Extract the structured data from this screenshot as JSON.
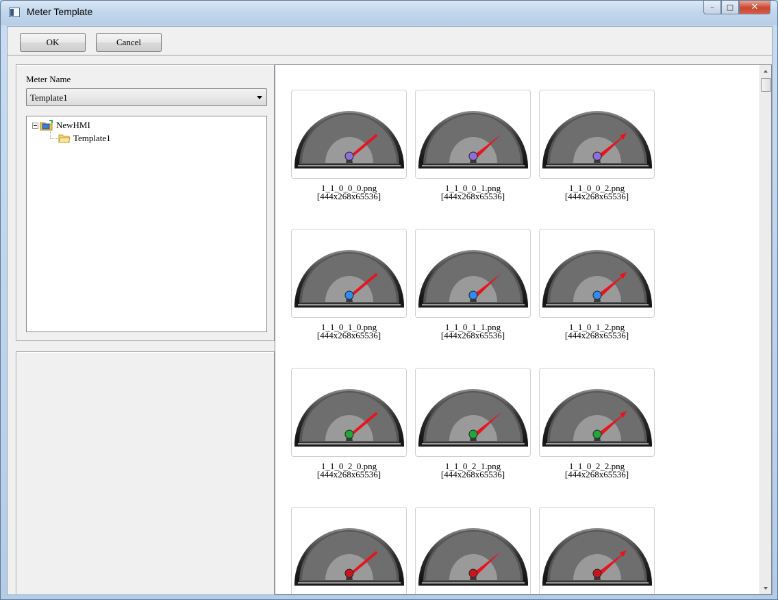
{
  "window": {
    "title": "Meter Template"
  },
  "toolbar": {
    "ok_label": "OK",
    "cancel_label": "Cancel"
  },
  "meter": {
    "label": "Meter Name",
    "selected": "Template1"
  },
  "tree": {
    "root": "NewHMI",
    "child": "Template1"
  },
  "gallery": {
    "tiles": [
      {
        "file": "1_1_0_0_0.png",
        "dims": "[444x268x65536]",
        "hub_color": "#8f6fd9",
        "needle": "line"
      },
      {
        "file": "1_1_0_0_1.png",
        "dims": "[444x268x65536]",
        "hub_color": "#8f6fd9",
        "needle": "wedge"
      },
      {
        "file": "1_1_0_0_2.png",
        "dims": "[444x268x65536]",
        "hub_color": "#8f6fd9",
        "needle": "arrow"
      },
      {
        "file": "1_1_0_1_0.png",
        "dims": "[444x268x65536]",
        "hub_color": "#2f8cf0",
        "needle": "line"
      },
      {
        "file": "1_1_0_1_1.png",
        "dims": "[444x268x65536]",
        "hub_color": "#2f8cf0",
        "needle": "wedge"
      },
      {
        "file": "1_1_0_1_2.png",
        "dims": "[444x268x65536]",
        "hub_color": "#2f8cf0",
        "needle": "arrow"
      },
      {
        "file": "1_1_0_2_0.png",
        "dims": "[444x268x65536]",
        "hub_color": "#22a73a",
        "needle": "line"
      },
      {
        "file": "1_1_0_2_1.png",
        "dims": "[444x268x65536]",
        "hub_color": "#22a73a",
        "needle": "wedge"
      },
      {
        "file": "1_1_0_2_2.png",
        "dims": "[444x268x65536]",
        "hub_color": "#22a73a",
        "needle": "arrow"
      },
      {
        "file": "",
        "dims": "",
        "hub_color": "#c8171c",
        "needle": "line"
      },
      {
        "file": "",
        "dims": "",
        "hub_color": "#c8171c",
        "needle": "wedge"
      },
      {
        "file": "",
        "dims": "",
        "hub_color": "#c8171c",
        "needle": "arrow"
      }
    ]
  },
  "colors": {
    "needle": "#e8141d",
    "dial_dark": "#3a3a3a",
    "dial_face": "#6e6e6e",
    "dial_inner": "#9a9a9a"
  }
}
